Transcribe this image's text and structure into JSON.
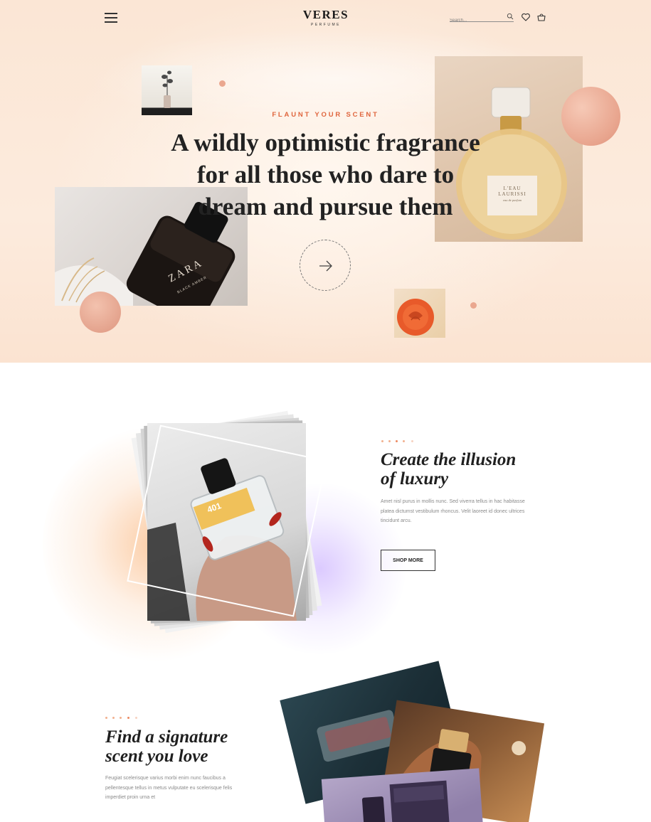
{
  "header": {
    "brand": "VERES",
    "brand_sub": "PERFUME",
    "search_placeholder": "Search..."
  },
  "hero": {
    "tagline": "FLAUNT YOUR SCENT",
    "headline": {
      "l1a": "A wildly ",
      "l1b": "optimistic fragrance",
      "l2": "for all those who dare to",
      "l3a": "dream and pursue",
      "l3b": " them"
    },
    "bottle_label_1": "ZARA",
    "bottle_label_1b": "BLACK AMBER",
    "bottle_label_2a": "L'EAU",
    "bottle_label_2b": "LAURISSI",
    "bottle_label_2c": "eau de parfum"
  },
  "feature_1": {
    "title_l1": "Create the illusion",
    "title_l2": "of luxury",
    "text": "Amet nisl purus in mollis nunc. Sed viverra tellus in hac habitasse platea dictumst vestibulum rhoncus. Velit laoreet id donec ultrices tincidunt arcu.",
    "button_label": "SHOP MORE",
    "bottle_label": "401"
  },
  "feature_2": {
    "title_l1": "Find a signature",
    "title_l2": "scent you love",
    "text": "Feugiat scelerisque varius morbi enim nunc faucibus a pellentesque tellus in metus vulputate eu scelerisque felis imperdiet proin urna et"
  },
  "icons": {
    "menu": "hamburger-icon",
    "search": "search-icon",
    "wishlist": "heart-icon",
    "cart": "basket-icon",
    "cta": "arrow-right-icon"
  },
  "colors": {
    "accent": "#e0663e",
    "hero_bg": "#fbe6d5",
    "dots": "#f2b08f"
  }
}
